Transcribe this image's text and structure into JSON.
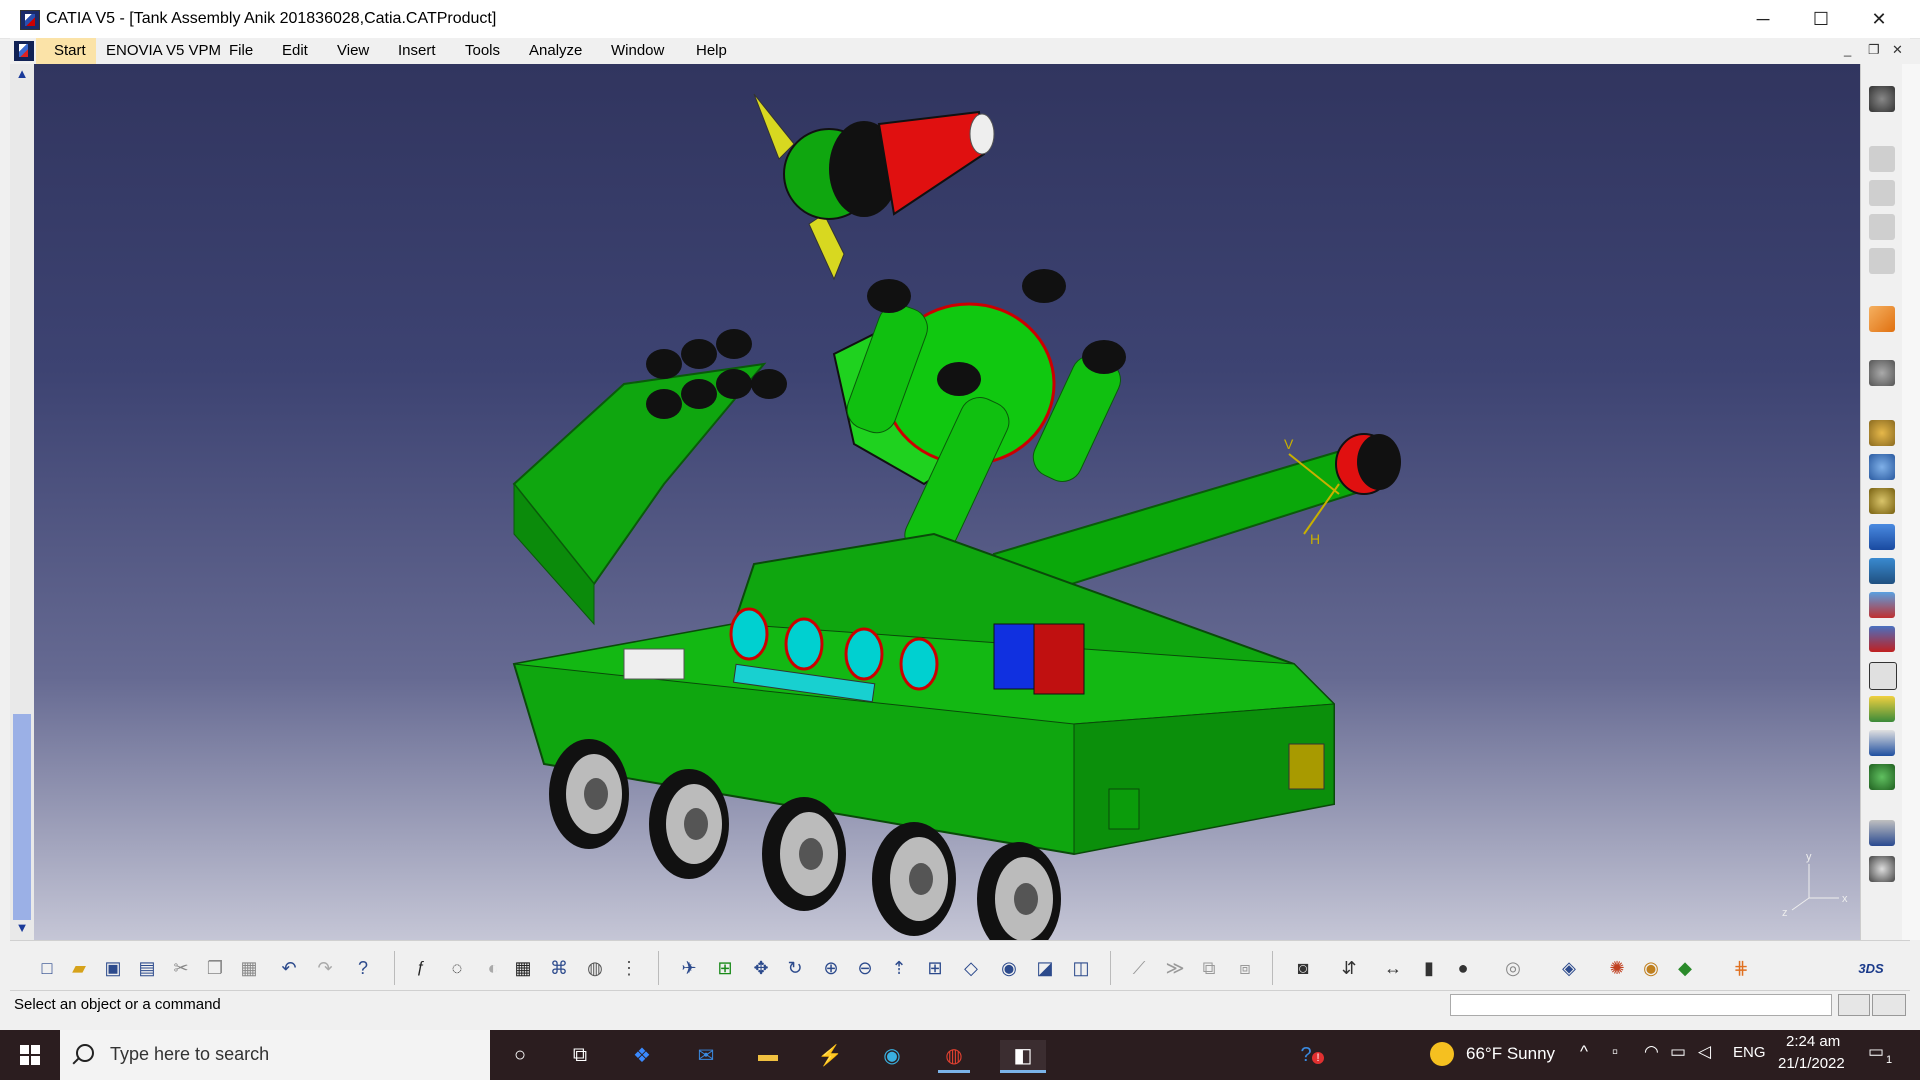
{
  "window": {
    "title": "CATIA V5 - [Tank Assembly Anik 201836028,Catia.CATProduct]",
    "minimize_glyph": "─",
    "maximize_glyph": "☐",
    "close_glyph": "✕"
  },
  "menubar": {
    "items": [
      "Start",
      "ENOVIA V5 VPM",
      "File",
      "Edit",
      "View",
      "Insert",
      "Tools",
      "Analyze",
      "Window",
      "Help"
    ],
    "doc_minimize": "_",
    "doc_restore": "❐",
    "doc_close": "✕"
  },
  "viewport": {
    "compass_labels": {
      "y": "y",
      "x": "x",
      "z": "z"
    },
    "gun_axis_labels": {
      "v": "V",
      "h": "H"
    }
  },
  "status": {
    "prompt": "Select an object or a command",
    "command_value": ""
  },
  "bottom_toolbar": {
    "icons": [
      "new-icon",
      "open-icon",
      "save-icon",
      "print-icon",
      "cut-icon",
      "copy-icon",
      "paste-icon",
      "undo-icon",
      "redo-icon",
      "whats-this-icon",
      "formula-icon",
      "comment-icon",
      "clash-icon",
      "table-icon",
      "tree-icon",
      "catalog-icon",
      "knowledge-icon",
      "fly-mode-icon",
      "fit-all-icon",
      "pan-icon",
      "rotate-icon",
      "zoom-in-icon",
      "zoom-out-icon",
      "normal-view-icon",
      "multi-view-icon",
      "iso-view-icon",
      "shading-icon",
      "hide-show-icon",
      "swap-space-icon",
      "measure-between-icon",
      "measure-item-icon",
      "clash-analysis-icon",
      "section-icon",
      "snapshot-icon",
      "manipulate-icon",
      "distance-icon",
      "sectioning-icon",
      "inertia-icon",
      "update-icon",
      "plane-icon",
      "material-icon",
      "render-icon",
      "apply-material-icon",
      "grid-icon",
      "catia-brand-icon"
    ]
  },
  "right_toolbar": {
    "icons": [
      "compass-icon",
      "product-1-icon",
      "product-2-icon",
      "product-3-icon",
      "product-4-icon",
      "select-icon",
      "gear-assembly-icon",
      "constraint-1-icon",
      "constraint-2-icon",
      "constraint-3-icon",
      "move-icon",
      "snap-icon",
      "explode-icon",
      "replace-icon",
      "bill-icon",
      "scene-icon",
      "graph-icon",
      "publication-icon",
      "drafting-icon",
      "catalog-assembly-icon"
    ]
  },
  "taskbar": {
    "search_placeholder": "Type here to search",
    "weather": "66°F  Sunny",
    "language": "ENG",
    "time": "2:24 am",
    "date": "21/1/2022",
    "notifications_count": "1",
    "help_badge": "!"
  },
  "colors": {
    "viewport_top": "#31355f",
    "viewport_bottom": "#c5c6d6",
    "tank_green": "#0fa60f",
    "taskbar": "#2b1d1f"
  }
}
